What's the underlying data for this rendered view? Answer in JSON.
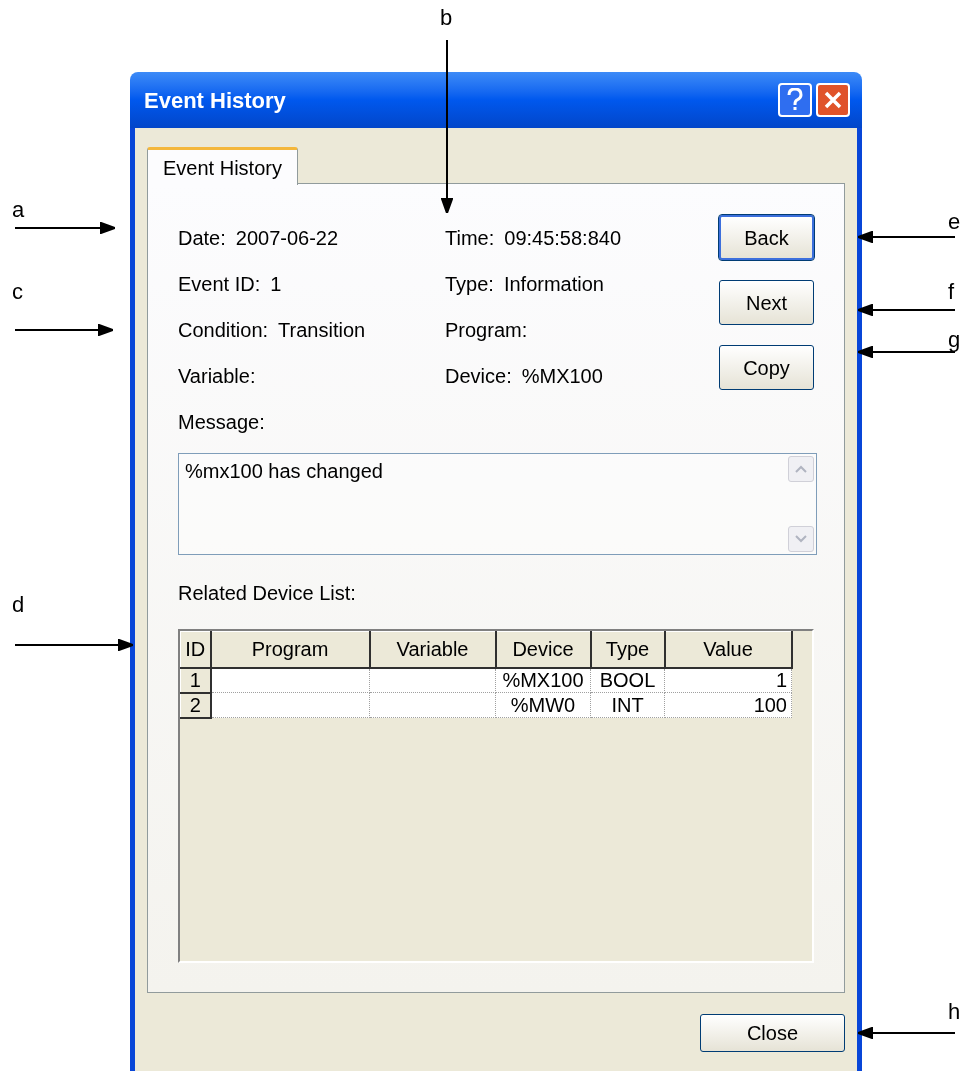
{
  "window": {
    "title": "Event History"
  },
  "tabs": [
    {
      "label": "Event History",
      "selected": true
    }
  ],
  "fields": [
    {
      "label": "Date:",
      "value": "2007-06-22"
    },
    {
      "label": "Time:",
      "value": "09:45:58:840"
    },
    {
      "label": "Event ID:",
      "value": "1"
    },
    {
      "label": "Type:",
      "value": "Information"
    },
    {
      "label": "Condition:",
      "value": "Transition"
    },
    {
      "label": "Program:"
    },
    {
      "label": "Variable:"
    },
    {
      "label": "Device:",
      "value": "%MX100"
    }
  ],
  "buttons": [
    {
      "label": "Back",
      "default": true
    },
    {
      "label": "Next",
      "default": false
    },
    {
      "label": "Copy",
      "default": false
    }
  ],
  "message": {
    "label": "Message:",
    "value": "%mx100 has changed"
  },
  "related_devices": {
    "label": "Related Device List:",
    "columns": [
      "ID",
      "Program",
      "Variable",
      "Device",
      "Type",
      "Value"
    ],
    "rows": [
      {
        "id": "1",
        "device": "%MX100",
        "type": "BOOL",
        "value": "1"
      },
      {
        "id": "2",
        "device": "%MW0",
        "type": "INT",
        "value": "100"
      }
    ]
  },
  "footer_button": "Close",
  "annotations": [
    {
      "label": "b"
    },
    {
      "label": "a"
    },
    {
      "label": "e"
    },
    {
      "label": "c"
    },
    {
      "label": "f"
    },
    {
      "label": "g"
    },
    {
      "label": "d"
    },
    {
      "label": "h"
    }
  ]
}
